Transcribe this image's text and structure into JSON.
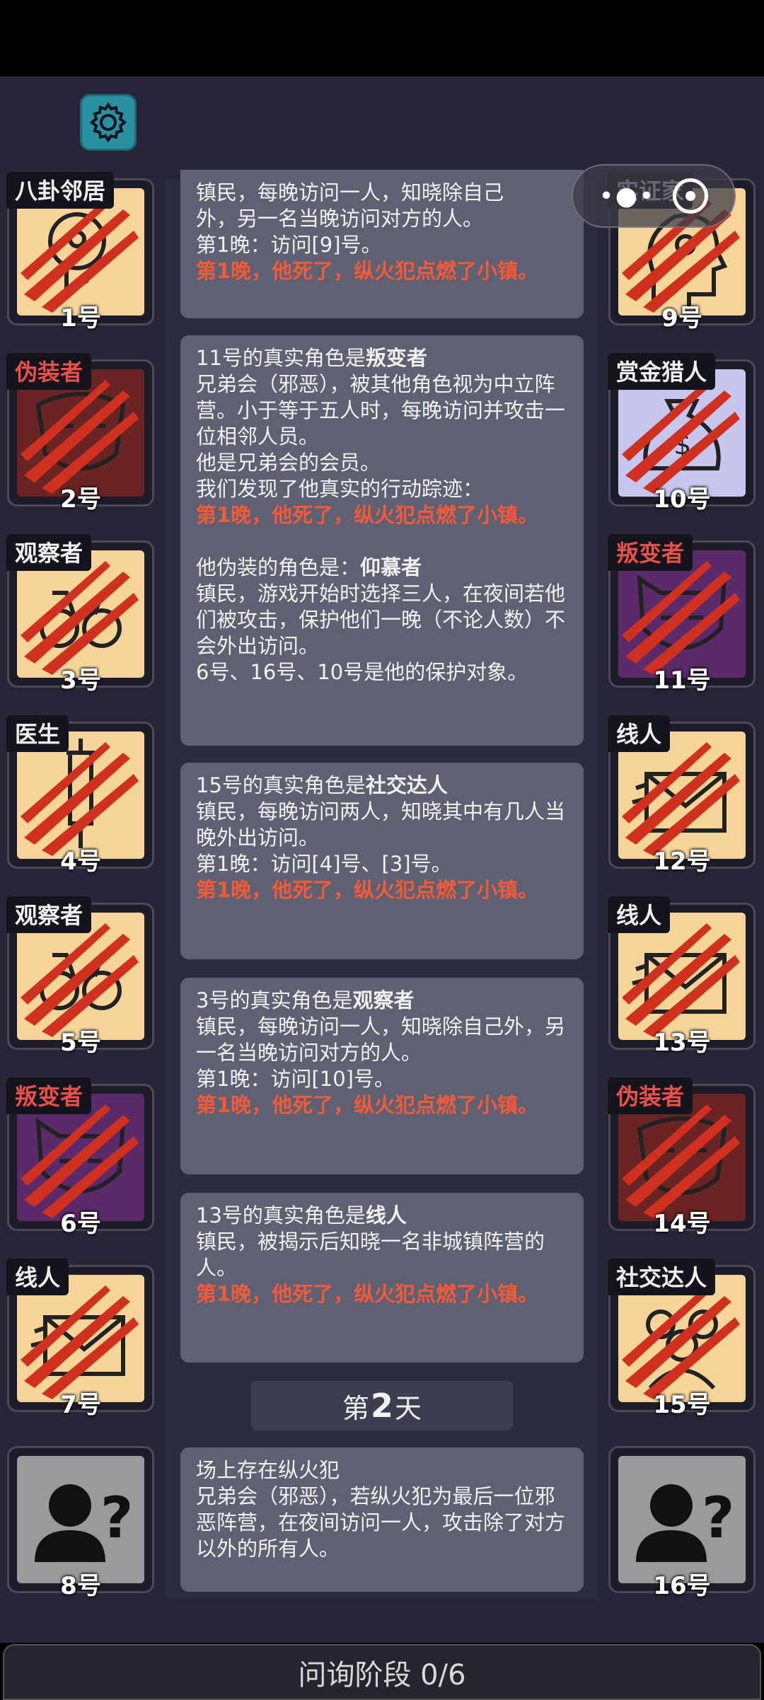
{
  "players_left": [
    {
      "role": "八卦邻居",
      "num": "1号",
      "evil": false
    },
    {
      "role": "伪装者",
      "num": "2号",
      "evil": true
    },
    {
      "role": "观察者",
      "num": "3号",
      "evil": false
    },
    {
      "role": "医生",
      "num": "4号",
      "evil": false
    },
    {
      "role": "观察者",
      "num": "5号",
      "evil": false
    },
    {
      "role": "叛变者",
      "num": "6号",
      "evil": true
    },
    {
      "role": "线人",
      "num": "7号",
      "evil": false
    },
    {
      "role": "",
      "num": "8号",
      "evil": false
    }
  ],
  "players_right": [
    {
      "role": "实证家",
      "num": "9号",
      "evil": false
    },
    {
      "role": "赏金猎人",
      "num": "10号",
      "evil": false
    },
    {
      "role": "叛变者",
      "num": "11号",
      "evil": true
    },
    {
      "role": "线人",
      "num": "12号",
      "evil": false
    },
    {
      "role": "线人",
      "num": "13号",
      "evil": false
    },
    {
      "role": "伪装者",
      "num": "14号",
      "evil": true
    },
    {
      "role": "社交达人",
      "num": "15号",
      "evil": false
    },
    {
      "role": "",
      "num": "16号",
      "evil": false
    }
  ],
  "log": {
    "msg0": {
      "l1": "镇民，每晚访问一人，知晓除自己",
      "l2": "外，另一名当晚访问对方的人。",
      "l3": "第1晚：访问[9]号。",
      "red": "第1晚，他死了，纵火犯点燃了小镇。"
    },
    "msg1": {
      "head_prefix": "11号的真实角色是",
      "head_role": "叛变者",
      "l1": "兄弟会（邪恶），被其他角色视为中立阵营。小于等于五人时，每晚访问并攻击一位相邻人员。",
      "l2": "他是兄弟会的会员。",
      "l3": "我们发现了他真实的行动踪迹：",
      "red": "第1晚，他死了，纵火犯点燃了小镇。",
      "disguise_prefix": "他伪装的角色是：",
      "disguise_role": "仰慕者",
      "l4": "镇民，游戏开始时选择三人，在夜间若他们被攻击，保护他们一晚（不论人数）不会外出访问。",
      "l5": "6号、16号、10号是他的保护对象。"
    },
    "msg2": {
      "head_prefix": "15号的真实角色是",
      "head_role": "社交达人",
      "l1": "镇民，每晚访问两人，知晓其中有几人当晚外出访问。",
      "l2": "第1晚：访问[4]号、[3]号。",
      "red": "第1晚，他死了，纵火犯点燃了小镇。"
    },
    "msg3": {
      "head_prefix": "3号的真实角色是",
      "head_role": "观察者",
      "l1": "镇民，每晚访问一人，知晓除自己外，另一名当晚访问对方的人。",
      "l2": "第1晚：访问[10]号。",
      "red": "第1晚，他死了，纵火犯点燃了小镇。"
    },
    "msg4": {
      "head_prefix": "13号的真实角色是",
      "head_role": "线人",
      "l1": "镇民，被揭示后知晓一名非城镇阵营的人。",
      "red": "第1晚，他死了，纵火犯点燃了小镇。"
    },
    "day": {
      "prefix": "第",
      "number": "2",
      "suffix": "天"
    },
    "msg5": {
      "l1": "场上存在纵火犯",
      "l2": "兄弟会（邪恶），若纵火犯为最后一位邪恶阵营，在夜间访问一人，攻击除了对方以外的所有人。"
    }
  },
  "phase": "问询阶段 0/6",
  "capsule": {
    "more_icon": "more-dots-icon",
    "close_icon": "target-close-icon"
  },
  "colors": {
    "accent_red": "#f25a3a",
    "card_cream": "#f7d59a",
    "card_red": "#6a2424",
    "card_purple": "#5a2a6a",
    "card_lavender": "#c6c6ee",
    "unknown_gray": "#9a9a9a"
  }
}
